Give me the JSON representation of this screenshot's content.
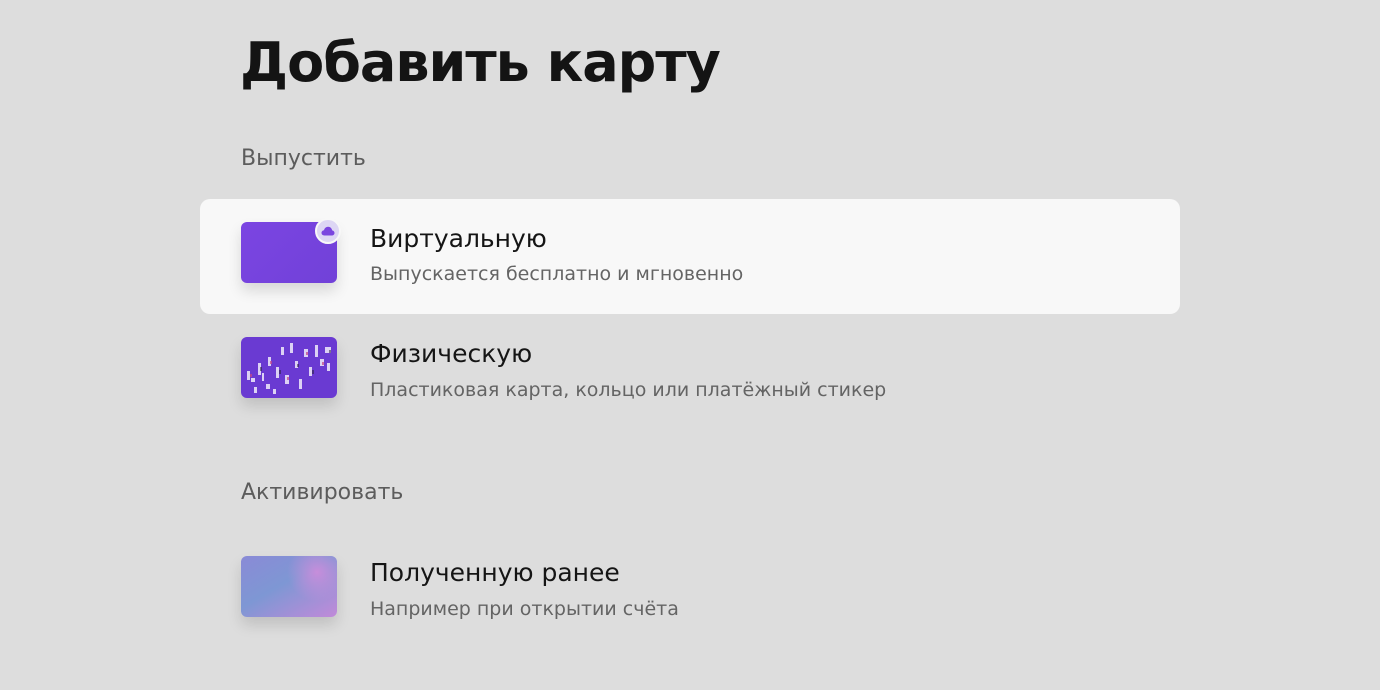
{
  "page": {
    "title": "Добавить карту"
  },
  "sections": [
    {
      "label": "Выпустить",
      "options": [
        {
          "title": "Виртуальную",
          "subtitle": "Выпускается бесплатно и мгновенно",
          "icon": "virtual-card-thumbnail",
          "badge_icon": "cloud-icon",
          "selected": true
        },
        {
          "title": "Физическую",
          "subtitle": "Пластиковая карта, кольцо или платёжный стикер",
          "icon": "physical-card-thumbnail",
          "selected": false
        }
      ]
    },
    {
      "label": "Активировать",
      "options": [
        {
          "title": "Полученную ранее",
          "subtitle": "Например при открытии счёта",
          "icon": "received-card-thumbnail",
          "selected": false
        }
      ]
    }
  ],
  "colors": {
    "background": "#dddddd",
    "selected_row": "#f8f8f8",
    "card_purple": "#7b45e2",
    "badge": "#ddd6f4"
  }
}
